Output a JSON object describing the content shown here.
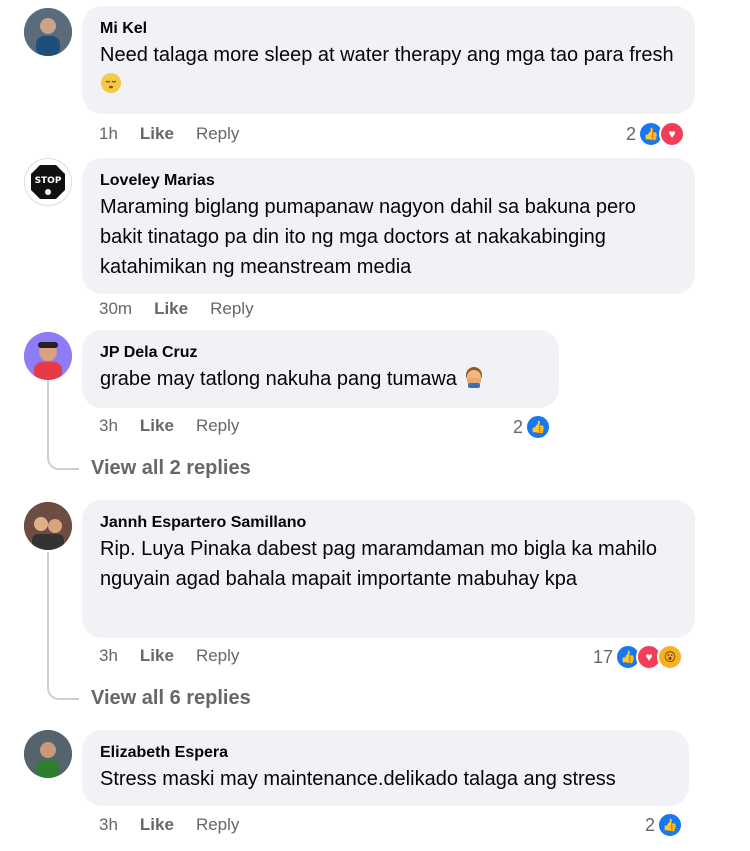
{
  "comments": [
    {
      "name": "Mi Kel",
      "text": "Need talaga more sleep at water therapy ang mga tao para fresh",
      "emoji": "sleep-face",
      "time": "1h",
      "like_label": "Like",
      "reply_label": "Reply",
      "reaction_count": "2",
      "reactions": [
        "like",
        "love"
      ]
    },
    {
      "name": "Loveley Marias",
      "text": "Maraming biglang pumapanaw nagyon dahil sa bakuna pero bakit tinatago pa din ito ng mga doctors at nakakabinging katahimikan ng meanstream media",
      "avatar_text": "STOP",
      "time": "30m",
      "like_label": "Like",
      "reply_label": "Reply"
    },
    {
      "name": "JP Dela Cruz",
      "text": "grabe may tatlong nakuha pang tumawa",
      "emoji": "facepalm",
      "time": "3h",
      "like_label": "Like",
      "reply_label": "Reply",
      "reaction_count": "2",
      "reactions": [
        "like"
      ],
      "view_replies": "View all 2 replies"
    },
    {
      "name": "Jannh Espartero Samillano",
      "text": "Rip. Luya Pinaka dabest pag maramdaman mo bigla ka mahilo nguyain agad bahala mapait importante mabuhay kpa",
      "time": "3h",
      "like_label": "Like",
      "reply_label": "Reply",
      "reaction_count": "17",
      "reactions": [
        "like",
        "love",
        "wow"
      ],
      "view_replies": "View all 6 replies"
    },
    {
      "name": "Elizabeth Espera",
      "text": "Stress maski may maintenance.delikado talaga ang stress",
      "time": "3h",
      "like_label": "Like",
      "reply_label": "Reply",
      "reaction_count": "2",
      "reactions": [
        "like"
      ]
    }
  ],
  "colors": {
    "bubble": "#f0f2f5",
    "meta": "#65676b",
    "like_blue": "#1877f2",
    "love_red": "#f33e58",
    "wow_yellow": "#f7b125"
  }
}
